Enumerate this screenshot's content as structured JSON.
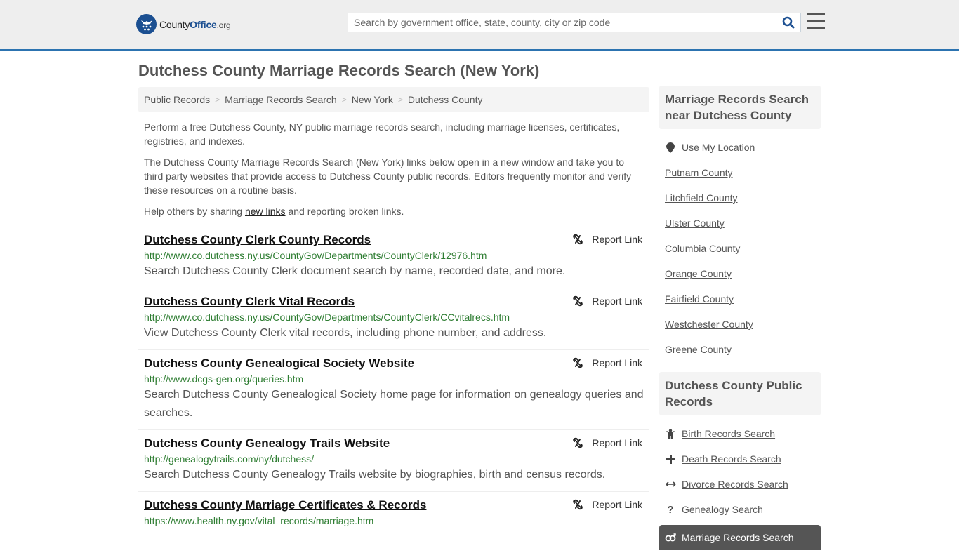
{
  "header": {
    "logo": {
      "name": "County",
      "accent": "Office",
      "tld": ".org"
    },
    "search": {
      "placeholder": "Search by government office, state, county, city or zip code",
      "value": ""
    },
    "colors": {
      "brand": "#1b4f91",
      "accent_border": "#2c73b0",
      "url_green": "#2e7d32"
    }
  },
  "page": {
    "title": "Dutchess County Marriage Records Search (New York)",
    "breadcrumb": [
      "Public Records",
      "Marriage Records Search",
      "New York",
      "Dutchess County"
    ],
    "intro": {
      "p1": "Perform a free Dutchess County, NY public marriage records search, including marriage licenses, certificates, registries, and indexes.",
      "p2": "The Dutchess County Marriage Records Search (New York) links below open in a new window and take you to third party websites that provide access to Dutchess County public records. Editors frequently monitor and verify these resources on a routine basis.",
      "p3_before": "Help others by sharing ",
      "p3_link": "new links",
      "p3_after": " and reporting broken links."
    },
    "report_label": "Report Link",
    "results": [
      {
        "title": "Dutchess County Clerk County Records",
        "url": "http://www.co.dutchess.ny.us/CountyGov/Departments/CountyClerk/12976.htm",
        "desc": "Search Dutchess County Clerk document search by name, recorded date, and more."
      },
      {
        "title": "Dutchess County Clerk Vital Records",
        "url": "http://www.co.dutchess.ny.us/CountyGov/Departments/CountyClerk/CCvitalrecs.htm",
        "desc": "View Dutchess County Clerk vital records, including phone number, and address."
      },
      {
        "title": "Dutchess County Genealogical Society Website",
        "url": "http://www.dcgs-gen.org/queries.htm",
        "desc": "Search Dutchess County Genealogical Society home page for information on genealogy queries and searches."
      },
      {
        "title": "Dutchess County Genealogy Trails Website",
        "url": "http://genealogytrails.com/ny/dutchess/",
        "desc": "Search Dutchess County Genealogy Trails website by biographies, birth and census records."
      },
      {
        "title": "Dutchess County Marriage Certificates & Records",
        "url": "https://www.health.ny.gov/vital_records/marriage.htm",
        "desc": ""
      }
    ]
  },
  "sidebar": {
    "nearby": {
      "heading": "Marriage Records Search near Dutchess County",
      "use_location": "Use My Location",
      "counties": [
        "Putnam County",
        "Litchfield County",
        "Ulster County",
        "Columbia County",
        "Orange County",
        "Fairfield County",
        "Westchester County",
        "Greene County"
      ]
    },
    "public_records": {
      "heading": "Dutchess County Public Records",
      "items": [
        {
          "label": "Birth Records Search",
          "icon": "child-icon"
        },
        {
          "label": "Death Records Search",
          "icon": "plus-icon"
        },
        {
          "label": "Divorce Records Search",
          "icon": "arrows-horizontal-icon"
        },
        {
          "label": "Genealogy Search",
          "icon": "question-icon"
        },
        {
          "label": "Marriage Records Search",
          "icon": "marriage-icon",
          "active": true
        }
      ]
    }
  }
}
